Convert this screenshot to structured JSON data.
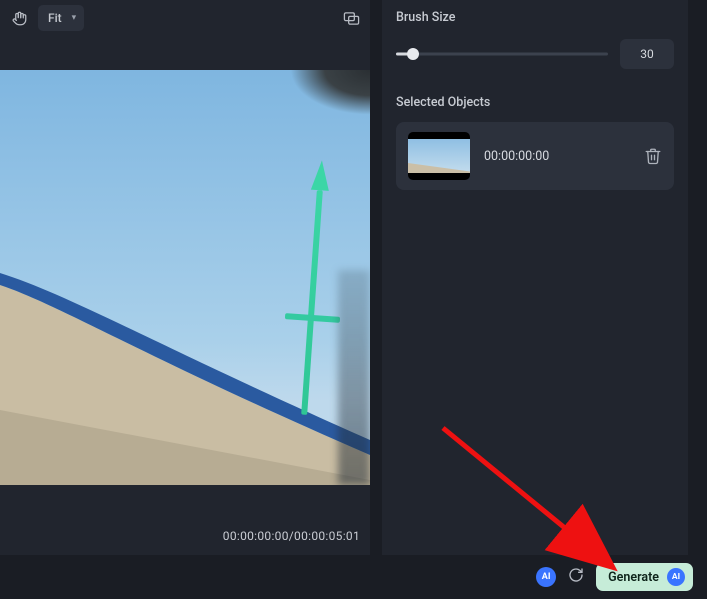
{
  "toolbar": {
    "zoom_label": "Fit"
  },
  "viewport": {
    "time_readout": "00:00:00:00/00:00:05:01"
  },
  "panel": {
    "brush_size_label": "Brush Size",
    "brush_size_value": "30",
    "selected_objects_label": "Selected Objects",
    "objects": [
      {
        "timestamp": "00:00:00:00"
      }
    ]
  },
  "footer": {
    "ai_badge": "AI",
    "generate_label": "Generate",
    "generate_badge": "AI"
  }
}
